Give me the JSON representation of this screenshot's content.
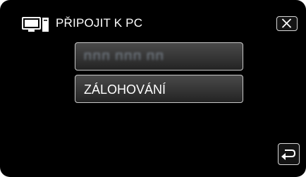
{
  "header": {
    "icon": "computer-monitor-icon",
    "title": "PŘIPOJIT K PC"
  },
  "controls": {
    "close_icon": "close-icon",
    "back_icon": "return-arrow-icon"
  },
  "options": [
    {
      "label": "ППП ППП ПП",
      "note_visible_state": "blurred"
    },
    {
      "label": "ZÁLOHOVÁNÍ"
    }
  ],
  "colors": {
    "background": "#000000",
    "button_border": "#c9c9c9",
    "text": "#ffffff",
    "blurred_text": "#8e9aa8"
  }
}
